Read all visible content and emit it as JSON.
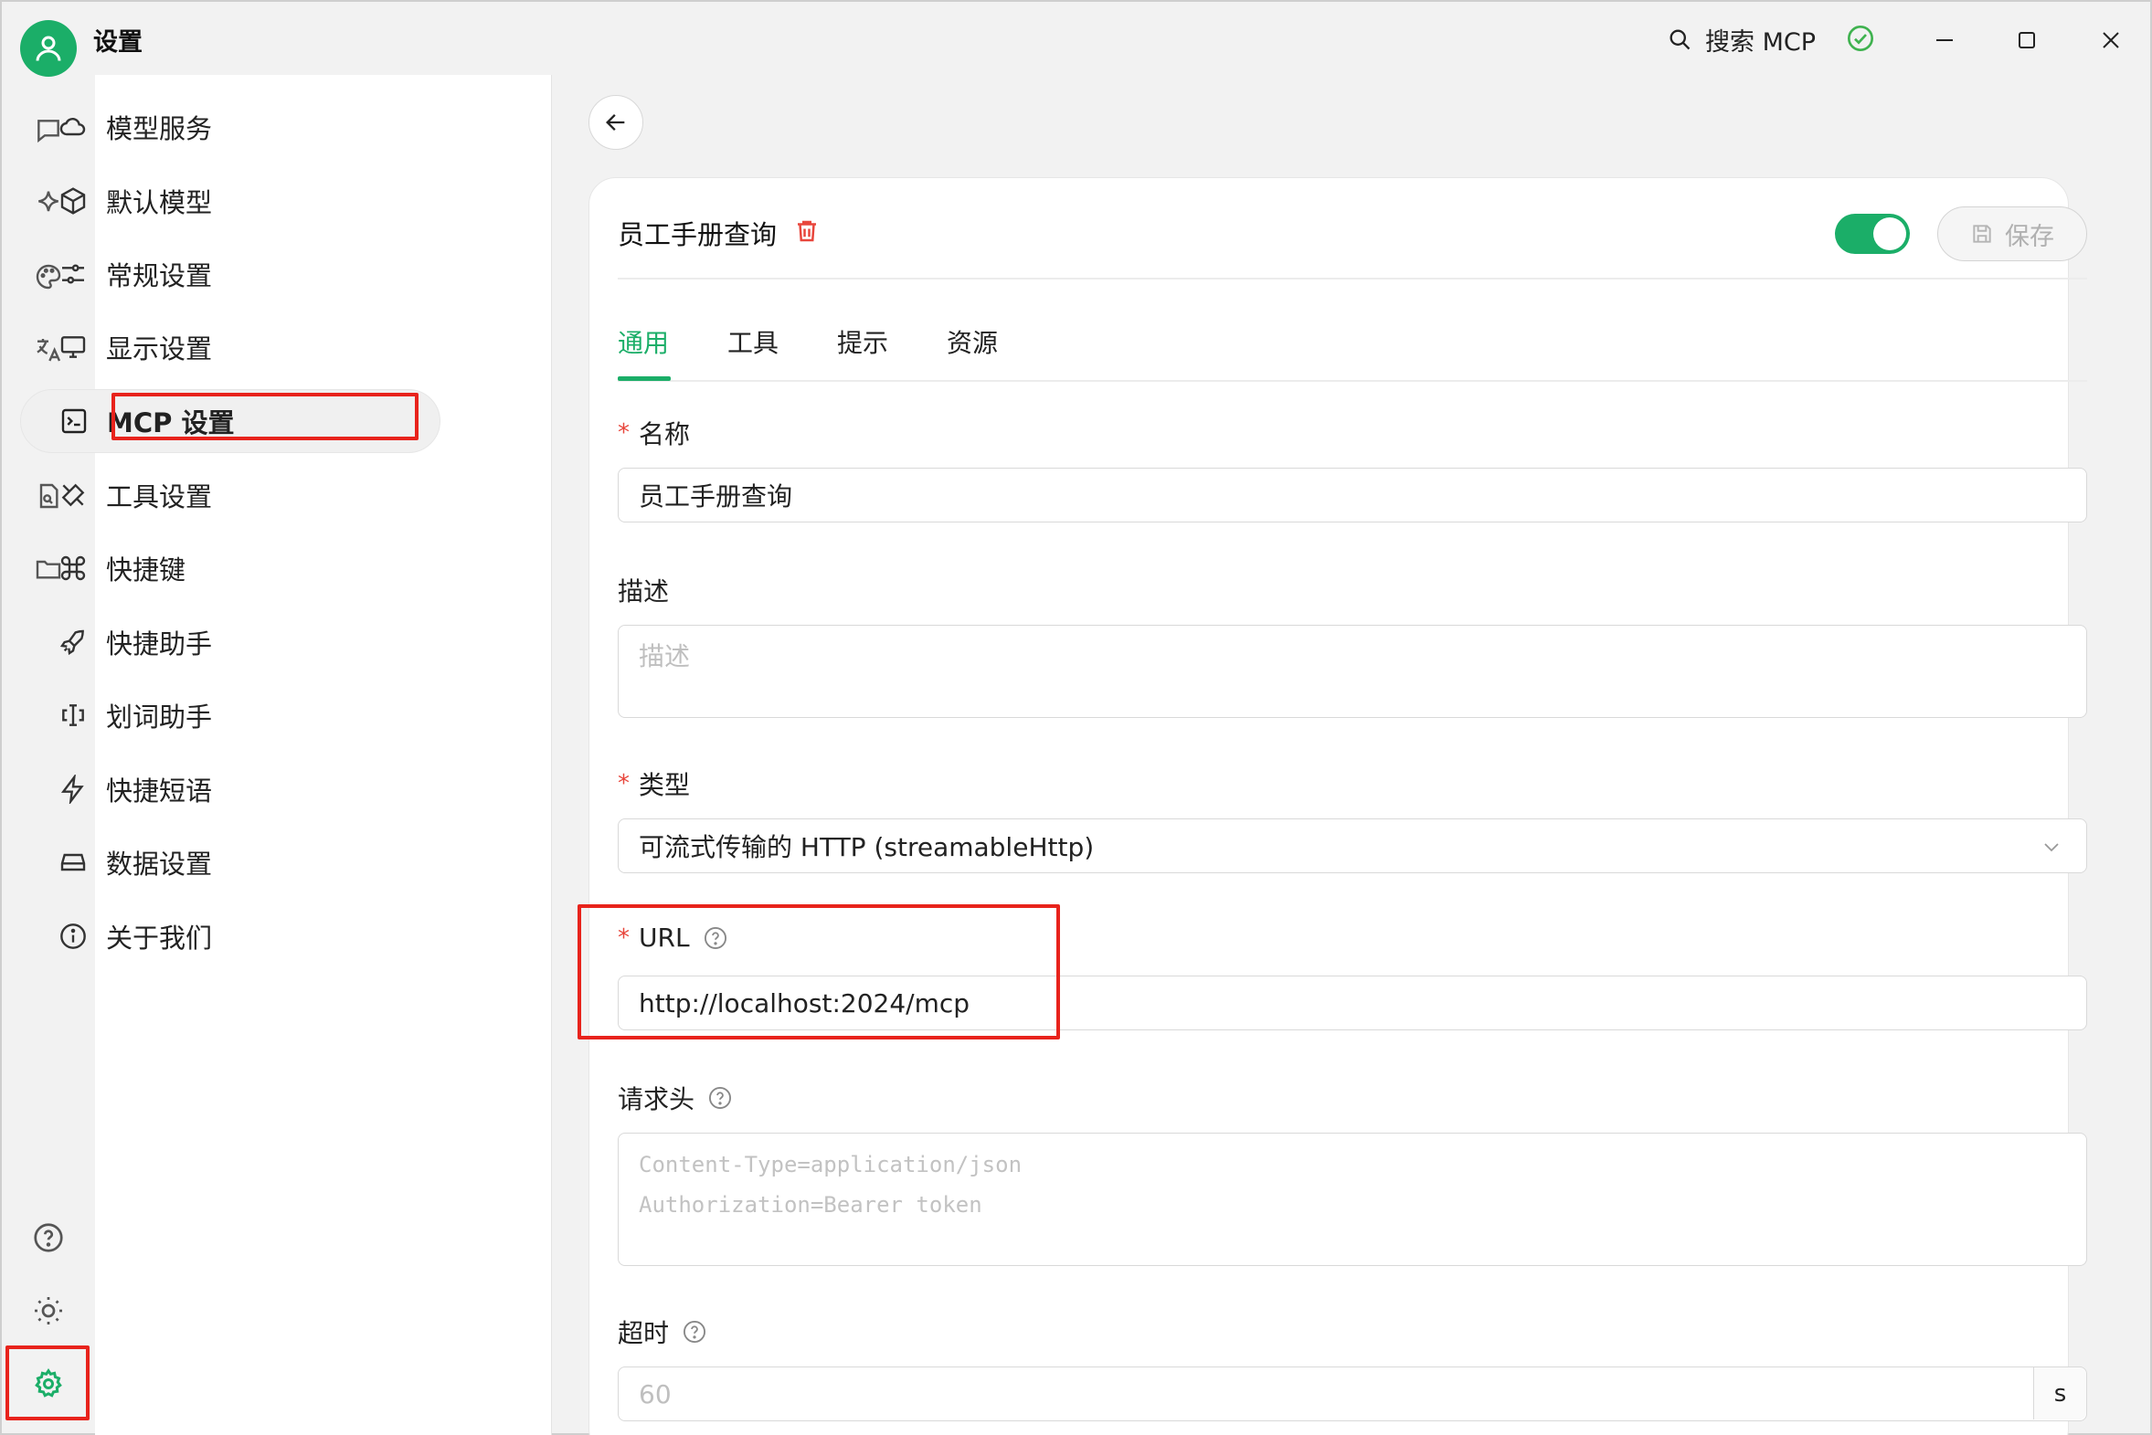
{
  "app": {
    "title": "设置"
  },
  "titlebar": {
    "search_label": "搜索 MCP"
  },
  "menu": {
    "items": [
      {
        "label": "模型服务",
        "icon": "cloud-icon"
      },
      {
        "label": "默认模型",
        "icon": "box-icon"
      },
      {
        "label": "常规设置",
        "icon": "sliders-icon"
      },
      {
        "label": "显示设置",
        "icon": "monitor-icon"
      },
      {
        "label": "MCP 设置",
        "icon": "terminal-icon",
        "active": true
      },
      {
        "label": "工具设置",
        "icon": "tools-icon"
      },
      {
        "label": "快捷键",
        "icon": "command-icon"
      },
      {
        "label": "快捷助手",
        "icon": "rocket-icon"
      },
      {
        "label": "划词助手",
        "icon": "text-cursor-icon"
      },
      {
        "label": "快捷短语",
        "icon": "zap-icon"
      },
      {
        "label": "数据设置",
        "icon": "hard-drive-icon"
      },
      {
        "label": "关于我们",
        "icon": "info-icon"
      }
    ]
  },
  "server": {
    "name": "员工手册查询",
    "enabled": true,
    "save_label": "保存"
  },
  "tabs": [
    "通用",
    "工具",
    "提示",
    "资源"
  ],
  "form": {
    "name_label": "名称",
    "name_value": "员工手册查询",
    "desc_label": "描述",
    "desc_placeholder": "描述",
    "type_label": "类型",
    "type_value": "可流式传输的 HTTP (streamableHttp)",
    "url_label": "URL",
    "url_value": "http://localhost:2024/mcp",
    "headers_label": "请求头",
    "headers_placeholder_1": "Content-Type=application/json",
    "headers_placeholder_2": "Authorization=Bearer token",
    "timeout_label": "超时",
    "timeout_placeholder": "60",
    "timeout_unit": "s"
  },
  "colors": {
    "accent": "#1bae68",
    "highlight_box": "#e8231c",
    "required": "#e8463c"
  }
}
